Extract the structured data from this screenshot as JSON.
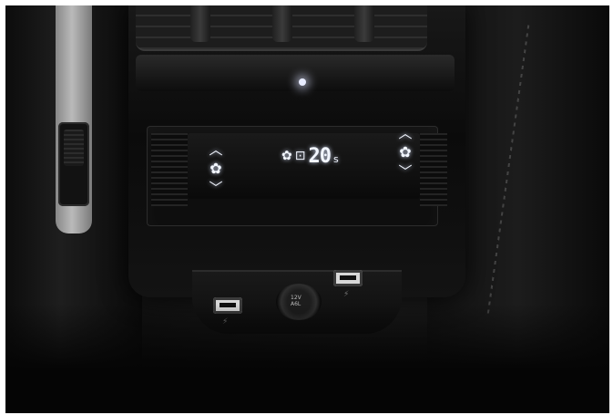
{
  "scene": {
    "description_type": "car-rear-climate-console-photo"
  },
  "climate_panel": {
    "left_zone": {
      "up_icon": "chevron-up-icon",
      "fan_icon": "fan-icon",
      "down_icon": "chevron-down-icon"
    },
    "right_zone": {
      "up_icon": "chevron-up-icon",
      "fan_icon": "fan-icon",
      "down_icon": "chevron-down-icon"
    },
    "display": {
      "fan_symbol": "✿",
      "lock_symbol": "🔒",
      "value": "20",
      "unit": "s"
    }
  },
  "power_outlet": {
    "label_voltage": "12V",
    "label_current": "A6L"
  },
  "colors": {
    "backlight": "#f2f6ff",
    "trim": "#0e0e0e",
    "usb_port": "#d8d8d8"
  }
}
